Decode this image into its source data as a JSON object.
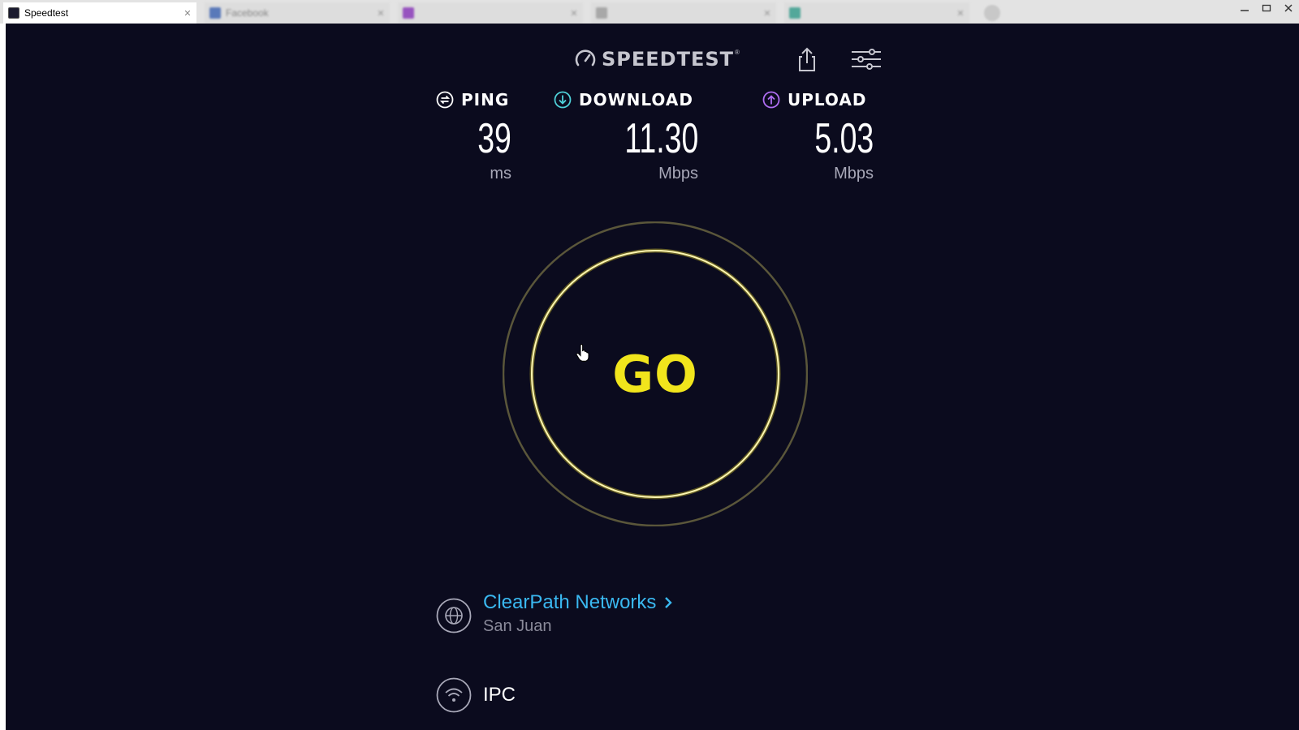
{
  "browser": {
    "tabs": [
      {
        "title": "Speedtest",
        "active": true,
        "favicon_color": "#1a1a2e"
      },
      {
        "title": "Facebook",
        "active": false,
        "favicon_color": "#4267b2"
      },
      {
        "title": "",
        "active": false,
        "favicon_color": "#8a3ab9"
      },
      {
        "title": "",
        "active": false,
        "favicon_color": "#9e9e9e"
      },
      {
        "title": "",
        "active": false,
        "favicon_color": "#3a9e8e"
      }
    ],
    "window_controls": [
      "minimize",
      "maximize",
      "close"
    ]
  },
  "header": {
    "logo_text": "SPEEDTEST",
    "logo_reg": "®",
    "share_icon": "share-icon",
    "settings_icon": "settings-sliders-icon"
  },
  "metrics": {
    "ping": {
      "label": "PING",
      "value": "39",
      "unit": "ms",
      "icon": "ping-icon",
      "color": "#ffffff"
    },
    "download": {
      "label": "DOWNLOAD",
      "value": "11.30",
      "unit": "Mbps",
      "icon": "download-arrow-icon",
      "color": "#4fd1d9"
    },
    "upload": {
      "label": "UPLOAD",
      "value": "5.03",
      "unit": "Mbps",
      "icon": "upload-arrow-icon",
      "color": "#b06ef3"
    }
  },
  "go_button": {
    "label": "GO",
    "color": "#f1e51c",
    "ring_color": "#fff7b0",
    "outer_ring_color": "#5a563a"
  },
  "server": {
    "name": "ClearPath Networks",
    "location": "San Juan",
    "icon": "globe-icon",
    "color": "#3ab8f0"
  },
  "isp": {
    "name": "IPC",
    "icon": "wifi-icon"
  },
  "colors": {
    "background": "#0b0b1e",
    "text_primary": "#ffffff",
    "text_secondary": "#a8a8b8"
  }
}
